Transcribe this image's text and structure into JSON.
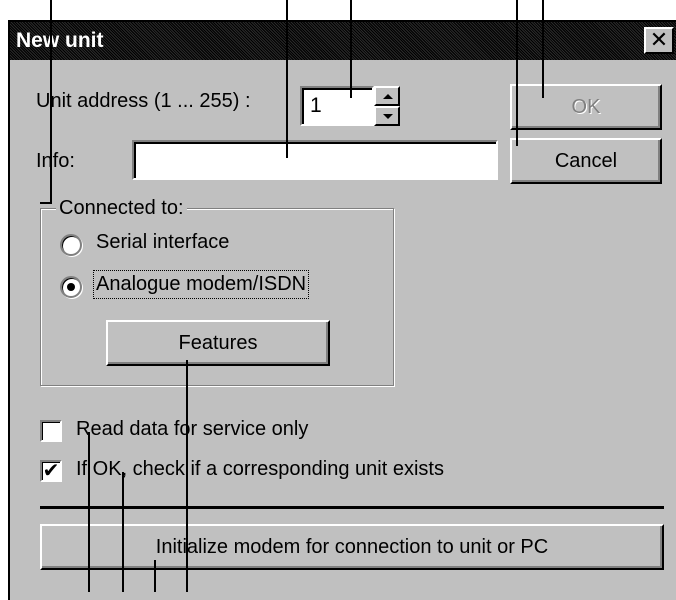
{
  "dialog": {
    "title": "New unit",
    "close_glyph": "✕",
    "unit_address_label": "Unit address (1 ... 255) :",
    "unit_address_value": "1",
    "info_label": "Info:",
    "info_value": "",
    "ok_label": "OK",
    "cancel_label": "Cancel",
    "connected_to_label": "Connected to:",
    "radio_serial_label": "Serial interface",
    "radio_modem_label": "Analogue modem/ISDN",
    "selected_connection": "Analogue modem/ISDN",
    "features_label": "Features",
    "read_data_label": "Read data for service only",
    "read_data_checked": false,
    "check_unit_label": "If OK, check if a corresponding unit exists",
    "check_unit_checked": true,
    "check_mark": "✔",
    "initialize_label": "Initialize modem for connection to unit or PC"
  },
  "icons": {
    "spin_up": "triangle-up-icon",
    "spin_down": "triangle-down-icon",
    "close": "close-icon"
  }
}
